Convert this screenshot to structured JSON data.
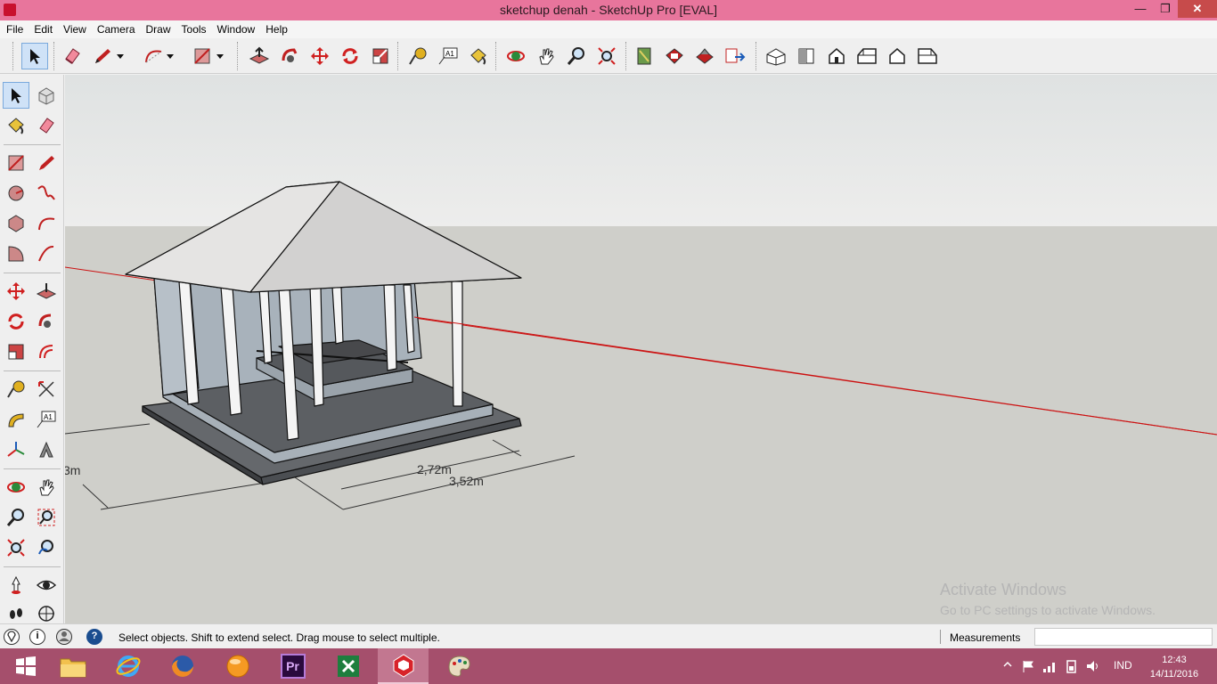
{
  "window": {
    "title": "sketchup denah - SketchUp Pro [EVAL]",
    "min_glyph": "—",
    "max_glyph": "❐",
    "close_glyph": "✕"
  },
  "menu": [
    "File",
    "Edit",
    "View",
    "Camera",
    "Draw",
    "Tools",
    "Window",
    "Help"
  ],
  "toolbar": {
    "icons": [
      "select-icon",
      "eraser-icon",
      "pencil-icon",
      "arc-icon",
      "rectangle-icon",
      "push-pull-icon",
      "follow-me-icon",
      "move-icon",
      "rotate-icon",
      "scale-icon",
      "tape-measure-icon",
      "text-icon",
      "paint-bucket-icon",
      "orbit-icon",
      "pan-icon",
      "zoom-icon",
      "zoom-extents-icon",
      "components-icon",
      "warehouse-icon",
      "share-model-icon",
      "send-to-layout-icon",
      "iso-view-icon",
      "top-view-icon",
      "front-view-icon",
      "right-view-icon",
      "back-view-icon",
      "left-view-icon"
    ]
  },
  "viewport": {
    "dimensions": {
      "inner": "2,72m",
      "outer": "3,52m",
      "left_partial": "3m"
    },
    "colors": {
      "sky": "#e7e9e9",
      "ground": "#cfcfca",
      "red_axis": "#cc1111"
    }
  },
  "status": {
    "message": "Select objects. Shift to extend select. Drag mouse to select multiple.",
    "measurements_label": "Measurements",
    "measurements_value": "",
    "info_glyph": "i",
    "help_glyph": "?"
  },
  "watermark": {
    "line1": "Activate Windows",
    "line2": "Go to PC settings to activate Windows."
  },
  "taskbar": {
    "apps": [
      "file-explorer",
      "internet-explorer",
      "firefox",
      "orange-app",
      "premiere-pro",
      "excel",
      "sketchup",
      "paint"
    ],
    "premiere_label": "Pr",
    "tray_language": "IND",
    "time": "12:43",
    "date": "14/11/2016",
    "colors": {
      "taskbar": "#a54f6c",
      "titlebar": "#e8759c"
    }
  }
}
